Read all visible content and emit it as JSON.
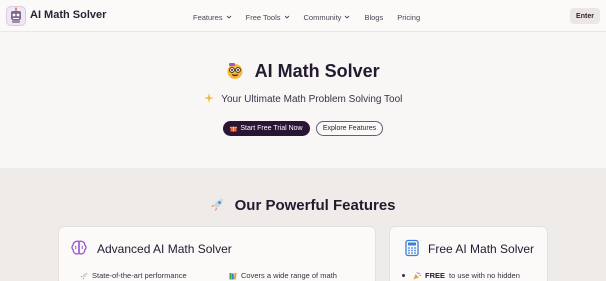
{
  "header": {
    "brand": "AI Math Solver",
    "nav": [
      {
        "label": "Features",
        "has_dropdown": true
      },
      {
        "label": "Free Tools",
        "has_dropdown": true
      },
      {
        "label": "Community",
        "has_dropdown": true
      },
      {
        "label": "Blogs",
        "has_dropdown": false
      },
      {
        "label": "Pricing",
        "has_dropdown": false
      }
    ],
    "enter_label": "Enter"
  },
  "hero": {
    "title": "AI Math Solver",
    "subtitle": "Your Ultimate Math Problem Solving Tool",
    "primary_cta": "Start Free Trial Now",
    "secondary_cta": "Explore Features"
  },
  "features": {
    "title": "Our Powerful Features",
    "cards": [
      {
        "title": "Advanced AI Math Solver",
        "icon": "brain-icon",
        "bullets": [
          "State-of-the-art performance",
          "Covers a wide range of math"
        ]
      },
      {
        "title": "Free AI Math Solver",
        "icon": "calculator-icon",
        "bullet_bold": "FREE",
        "bullet_rest": " to use with no hidden"
      }
    ]
  },
  "colors": {
    "accent": "#2a1535",
    "brain": "#9b59c9",
    "calculator": "#3b7dd8"
  }
}
